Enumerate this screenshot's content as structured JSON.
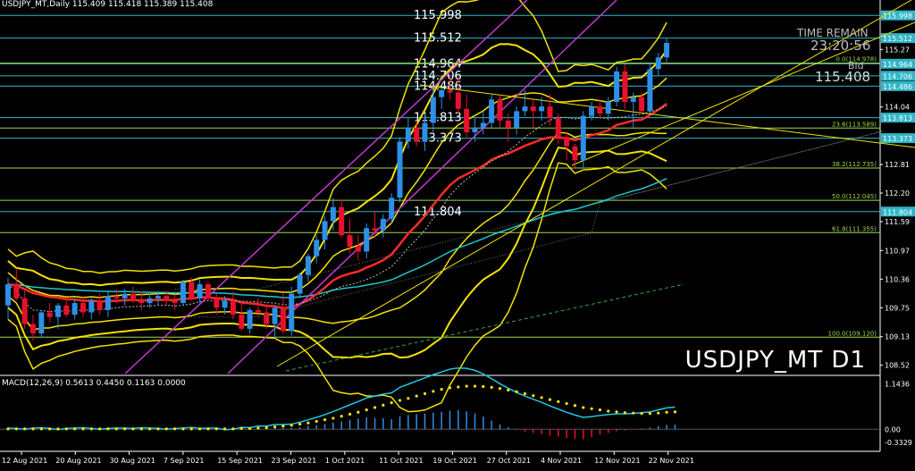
{
  "header": {
    "title": "USDJPY_MT,Daily  115.409 115.418 115.389 115.408",
    "macd_label": "MACD(12,26,9) 0.5613 0.4450 0.1163 0.0000",
    "watermark": "USDJPY_MT D1",
    "timer_label": "TIME REMAIN",
    "timer_value": "23:20:56",
    "bid_label": "Bid",
    "bid_value": "115.408"
  },
  "colors": {
    "background": "#000000",
    "bull": "#2e8fe6",
    "bear": "#e8112d",
    "bollinger": "#f3e300",
    "channel": "#c13ad1",
    "fib": "#9fd64f",
    "level": "#2fb6c7",
    "ema_fast": "#ff2b2b",
    "ema_slow": "#1ec8c8",
    "macd_line": "#1ec8e0",
    "macd_signal": "#ffe600",
    "axis_text": "#ffffff"
  },
  "chart_data": [
    {
      "type": "candlestick",
      "title": "USDJPY_MT,Daily",
      "x_ticks": [
        "12 Aug 2021",
        "20 Aug 2021",
        "30 Aug 2021",
        "7 Sep 2021",
        "15 Sep 2021",
        "23 Sep 2021",
        "1 Oct 2021",
        "11 Oct 2021",
        "19 Oct 2021",
        "27 Oct 2021",
        "4 Nov 2021",
        "12 Nov 2021",
        "22 Nov 2021"
      ],
      "y_ticks": [
        115.998,
        115.512,
        115.27,
        114.964,
        114.706,
        114.486,
        114.04,
        113.813,
        113.373,
        112.81,
        112.2,
        111.804,
        111.59,
        110.97,
        110.36,
        109.75,
        109.13,
        108.52
      ],
      "ylim": [
        108.38,
        116.25
      ],
      "grid": false,
      "candles": [
        {
          "date": "2021-08-05",
          "o": 109.8,
          "h": 110.38,
          "l": 109.5,
          "c": 110.25
        },
        {
          "date": "2021-08-06",
          "o": 110.25,
          "h": 110.6,
          "l": 109.9,
          "c": 109.95
        },
        {
          "date": "2021-08-09",
          "o": 109.95,
          "h": 110.15,
          "l": 109.3,
          "c": 109.4
        },
        {
          "date": "2021-08-10",
          "o": 109.4,
          "h": 109.6,
          "l": 109.05,
          "c": 109.2
        },
        {
          "date": "2021-08-11",
          "o": 109.2,
          "h": 109.7,
          "l": 109.1,
          "c": 109.65
        },
        {
          "date": "2021-08-12",
          "o": 109.65,
          "h": 109.85,
          "l": 109.45,
          "c": 109.55
        },
        {
          "date": "2021-08-13",
          "o": 109.55,
          "h": 109.85,
          "l": 109.3,
          "c": 109.8
        },
        {
          "date": "2021-08-16",
          "o": 109.8,
          "h": 109.95,
          "l": 109.55,
          "c": 109.6
        },
        {
          "date": "2021-08-17",
          "o": 109.6,
          "h": 109.95,
          "l": 109.5,
          "c": 109.85
        },
        {
          "date": "2021-08-18",
          "o": 109.85,
          "h": 110.0,
          "l": 109.55,
          "c": 109.65
        },
        {
          "date": "2021-08-19",
          "o": 109.65,
          "h": 109.95,
          "l": 109.5,
          "c": 109.9
        },
        {
          "date": "2021-08-20",
          "o": 109.9,
          "h": 110.05,
          "l": 109.6,
          "c": 109.7
        },
        {
          "date": "2021-08-23",
          "o": 109.7,
          "h": 110.1,
          "l": 109.55,
          "c": 110.0
        },
        {
          "date": "2021-08-24",
          "o": 110.0,
          "h": 110.15,
          "l": 109.85,
          "c": 109.95
        },
        {
          "date": "2021-08-25",
          "o": 109.95,
          "h": 110.15,
          "l": 109.8,
          "c": 110.05
        },
        {
          "date": "2021-08-26",
          "o": 110.05,
          "h": 110.2,
          "l": 109.85,
          "c": 109.9
        },
        {
          "date": "2021-08-27",
          "o": 109.9,
          "h": 110.1,
          "l": 109.7,
          "c": 109.85
        },
        {
          "date": "2021-08-30",
          "o": 109.85,
          "h": 110.05,
          "l": 109.75,
          "c": 109.95
        },
        {
          "date": "2021-08-31",
          "o": 109.95,
          "h": 110.1,
          "l": 109.8,
          "c": 110.0
        },
        {
          "date": "2021-09-01",
          "o": 110.0,
          "h": 110.1,
          "l": 109.8,
          "c": 109.9
        },
        {
          "date": "2021-09-02",
          "o": 109.9,
          "h": 110.05,
          "l": 109.7,
          "c": 109.85
        },
        {
          "date": "2021-09-03",
          "o": 109.85,
          "h": 110.35,
          "l": 109.8,
          "c": 110.3
        },
        {
          "date": "2021-09-06",
          "o": 110.3,
          "h": 110.4,
          "l": 109.9,
          "c": 109.95
        },
        {
          "date": "2021-09-07",
          "o": 109.95,
          "h": 110.35,
          "l": 109.85,
          "c": 110.25
        },
        {
          "date": "2021-09-08",
          "o": 110.25,
          "h": 110.3,
          "l": 109.9,
          "c": 109.95
        },
        {
          "date": "2021-09-09",
          "o": 109.95,
          "h": 110.05,
          "l": 109.6,
          "c": 109.75
        },
        {
          "date": "2021-09-10",
          "o": 109.75,
          "h": 110.0,
          "l": 109.6,
          "c": 109.9
        },
        {
          "date": "2021-09-13",
          "o": 109.9,
          "h": 110.1,
          "l": 109.5,
          "c": 109.6
        },
        {
          "date": "2021-09-14",
          "o": 109.6,
          "h": 109.9,
          "l": 109.25,
          "c": 109.3
        },
        {
          "date": "2021-09-15",
          "o": 109.3,
          "h": 109.75,
          "l": 109.2,
          "c": 109.7
        },
        {
          "date": "2021-09-16",
          "o": 109.7,
          "h": 109.95,
          "l": 109.55,
          "c": 109.65
        },
        {
          "date": "2021-09-17",
          "o": 109.65,
          "h": 109.85,
          "l": 109.3,
          "c": 109.4
        },
        {
          "date": "2021-09-20",
          "o": 109.4,
          "h": 109.8,
          "l": 109.1,
          "c": 109.75
        },
        {
          "date": "2021-09-21",
          "o": 109.75,
          "h": 110.05,
          "l": 109.2,
          "c": 109.25
        },
        {
          "date": "2021-09-22",
          "o": 109.25,
          "h": 110.2,
          "l": 109.15,
          "c": 110.05
        },
        {
          "date": "2021-09-23",
          "o": 110.05,
          "h": 110.5,
          "l": 109.95,
          "c": 110.45
        },
        {
          "date": "2021-09-24",
          "o": 110.45,
          "h": 110.9,
          "l": 110.3,
          "c": 110.85
        },
        {
          "date": "2021-09-27",
          "o": 110.85,
          "h": 111.3,
          "l": 110.7,
          "c": 111.2
        },
        {
          "date": "2021-09-28",
          "o": 111.2,
          "h": 111.7,
          "l": 111.0,
          "c": 111.6
        },
        {
          "date": "2021-09-29",
          "o": 111.6,
          "h": 112.1,
          "l": 111.4,
          "c": 111.9
        },
        {
          "date": "2021-09-30",
          "o": 111.9,
          "h": 112.05,
          "l": 111.25,
          "c": 111.3
        },
        {
          "date": "2021-10-01",
          "o": 111.3,
          "h": 111.65,
          "l": 110.9,
          "c": 111.05
        },
        {
          "date": "2021-10-04",
          "o": 111.05,
          "h": 111.3,
          "l": 110.75,
          "c": 110.95
        },
        {
          "date": "2021-10-05",
          "o": 110.95,
          "h": 111.55,
          "l": 110.8,
          "c": 111.45
        },
        {
          "date": "2021-10-06",
          "o": 111.45,
          "h": 111.8,
          "l": 111.25,
          "c": 111.4
        },
        {
          "date": "2021-10-07",
          "o": 111.4,
          "h": 111.75,
          "l": 111.25,
          "c": 111.65
        },
        {
          "date": "2021-10-08",
          "o": 111.65,
          "h": 112.2,
          "l": 111.55,
          "c": 112.1
        },
        {
          "date": "2021-10-11",
          "o": 112.1,
          "h": 113.4,
          "l": 112.0,
          "c": 113.3
        },
        {
          "date": "2021-10-12",
          "o": 113.3,
          "h": 113.8,
          "l": 113.15,
          "c": 113.6
        },
        {
          "date": "2021-10-13",
          "o": 113.6,
          "h": 113.75,
          "l": 113.2,
          "c": 113.3
        },
        {
          "date": "2021-10-14",
          "o": 113.3,
          "h": 113.9,
          "l": 113.1,
          "c": 113.7
        },
        {
          "date": "2021-10-15",
          "o": 113.7,
          "h": 114.4,
          "l": 113.5,
          "c": 114.25
        },
        {
          "date": "2021-10-18",
          "o": 114.25,
          "h": 114.45,
          "l": 114.0,
          "c": 114.4
        },
        {
          "date": "2021-10-19",
          "o": 114.4,
          "h": 114.7,
          "l": 114.2,
          "c": 114.35
        },
        {
          "date": "2021-10-20",
          "o": 114.35,
          "h": 114.69,
          "l": 113.9,
          "c": 114.0
        },
        {
          "date": "2021-10-21",
          "o": 114.0,
          "h": 114.3,
          "l": 113.4,
          "c": 113.5
        },
        {
          "date": "2021-10-22",
          "o": 113.5,
          "h": 113.8,
          "l": 113.3,
          "c": 113.6
        },
        {
          "date": "2021-10-25",
          "o": 113.6,
          "h": 113.95,
          "l": 113.45,
          "c": 113.7
        },
        {
          "date": "2021-10-26",
          "o": 113.7,
          "h": 114.3,
          "l": 113.6,
          "c": 114.2
        },
        {
          "date": "2021-10-27",
          "o": 114.2,
          "h": 114.3,
          "l": 113.6,
          "c": 113.75
        },
        {
          "date": "2021-10-28",
          "o": 113.75,
          "h": 113.9,
          "l": 113.3,
          "c": 113.6
        },
        {
          "date": "2021-10-29",
          "o": 113.6,
          "h": 114.05,
          "l": 113.45,
          "c": 113.95
        },
        {
          "date": "2021-11-01",
          "o": 113.95,
          "h": 114.4,
          "l": 113.85,
          "c": 114.05
        },
        {
          "date": "2021-11-02",
          "o": 114.05,
          "h": 114.2,
          "l": 113.6,
          "c": 113.95
        },
        {
          "date": "2021-11-03",
          "o": 113.95,
          "h": 114.25,
          "l": 113.75,
          "c": 114.05
        },
        {
          "date": "2021-11-04",
          "o": 114.05,
          "h": 114.3,
          "l": 113.65,
          "c": 113.8
        },
        {
          "date": "2021-11-05",
          "o": 113.8,
          "h": 113.9,
          "l": 113.25,
          "c": 113.4
        },
        {
          "date": "2021-11-08",
          "o": 113.4,
          "h": 113.5,
          "l": 112.9,
          "c": 113.2
        },
        {
          "date": "2021-11-09",
          "o": 113.2,
          "h": 113.25,
          "l": 112.75,
          "c": 112.9
        },
        {
          "date": "2021-11-10",
          "o": 112.9,
          "h": 113.95,
          "l": 112.75,
          "c": 113.85
        },
        {
          "date": "2021-11-11",
          "o": 113.85,
          "h": 114.15,
          "l": 113.75,
          "c": 114.05
        },
        {
          "date": "2021-11-12",
          "o": 114.05,
          "h": 114.2,
          "l": 113.8,
          "c": 113.9
        },
        {
          "date": "2021-11-15",
          "o": 113.9,
          "h": 114.25,
          "l": 113.75,
          "c": 114.15
        },
        {
          "date": "2021-11-16",
          "o": 114.15,
          "h": 114.9,
          "l": 114.05,
          "c": 114.8
        },
        {
          "date": "2021-11-17",
          "o": 114.8,
          "h": 114.95,
          "l": 114.0,
          "c": 114.15
        },
        {
          "date": "2021-11-18",
          "o": 114.15,
          "h": 114.35,
          "l": 113.6,
          "c": 114.25
        },
        {
          "date": "2021-11-19",
          "o": 114.25,
          "h": 114.35,
          "l": 113.9,
          "c": 113.95
        },
        {
          "date": "2021-11-22",
          "o": 113.95,
          "h": 114.95,
          "l": 113.9,
          "c": 114.85
        },
        {
          "date": "2021-11-23",
          "o": 114.85,
          "h": 115.2,
          "l": 114.7,
          "c": 115.1
        },
        {
          "date": "2021-11-24",
          "o": 115.1,
          "h": 115.52,
          "l": 115.0,
          "c": 115.41
        }
      ],
      "horizontal_levels": [
        115.998,
        115.512,
        114.964,
        114.706,
        114.486,
        113.813,
        113.373,
        111.804
      ],
      "fibonacci": [
        {
          "label": "0.0(114.978)",
          "value": 114.978
        },
        {
          "label": "23.6(113.589)",
          "value": 113.589
        },
        {
          "label": "38.2(112.735)",
          "value": 112.735
        },
        {
          "label": "50.0(112.045)",
          "value": 112.045
        },
        {
          "label": "61.8(111.355)",
          "value": 111.355
        },
        {
          "label": "100.0(109.120)",
          "value": 109.12
        }
      ]
    },
    {
      "type": "bar",
      "title": "MACD(12,26,9)",
      "y_ticks": [
        1.1436,
        0,
        -0.3329
      ],
      "y_tick_labels": [
        "1.1436",
        "0.00",
        "-0.3329"
      ],
      "ylim": [
        -0.4,
        1.25
      ],
      "series": [
        {
          "name": "histogram",
          "values": [
            0.02,
            0.01,
            -0.01,
            0.02,
            0.03,
            0.01,
            -0.02,
            0.01,
            0.02,
            0.03,
            0.01,
            -0.01,
            0.01,
            0.02,
            0.02,
            0.01,
            0.03,
            0.02,
            0.01,
            -0.01,
            0.01,
            0.02,
            0.04,
            0.01,
            0.02,
            0.02,
            -0.02,
            -0.01,
            0.03,
            0.02,
            0.05,
            0.04,
            0.06,
            0.04,
            0.03,
            0.05,
            0.08,
            0.1,
            0.13,
            0.17,
            0.2,
            0.24,
            0.27,
            0.3,
            0.29,
            0.28,
            0.25,
            0.33,
            0.36,
            0.38,
            0.4,
            0.42,
            0.44,
            0.47,
            0.48,
            0.45,
            0.4,
            0.32,
            0.22,
            0.12,
            0.05,
            -0.02,
            -0.06,
            -0.09,
            -0.12,
            -0.16,
            -0.19,
            -0.22,
            -0.24,
            -0.25,
            -0.2,
            -0.14,
            -0.09,
            -0.05,
            -0.03,
            -0.01,
            0.02,
            0.04,
            0.08,
            0.11,
            0.12
          ]
        },
        {
          "name": "signal",
          "values": [
            0.01,
            0.01,
            0.01,
            0.01,
            0.01,
            0.01,
            0.01,
            0.01,
            0.01,
            0.01,
            0.01,
            0.01,
            0.01,
            0.01,
            0.01,
            0.01,
            0.01,
            0.01,
            0.01,
            0.01,
            0.01,
            0.01,
            0.01,
            0.01,
            0.01,
            0.01,
            0.01,
            0.01,
            0.02,
            0.02,
            0.03,
            0.04,
            0.06,
            0.08,
            0.1,
            0.13,
            0.16,
            0.2,
            0.24,
            0.28,
            0.33,
            0.38,
            0.43,
            0.49,
            0.55,
            0.61,
            0.67,
            0.73,
            0.78,
            0.84,
            0.9,
            0.96,
            1.01,
            1.05,
            1.07,
            1.09,
            1.09,
            1.08,
            1.06,
            1.03,
            0.99,
            0.95,
            0.9,
            0.85,
            0.8,
            0.75,
            0.7,
            0.65,
            0.6,
            0.55,
            0.52,
            0.49,
            0.46,
            0.44,
            0.42,
            0.41,
            0.4,
            0.4,
            0.41,
            0.43,
            0.44
          ]
        },
        {
          "name": "macd",
          "values": [
            0.03,
            0.02,
            0.0,
            0.03,
            0.04,
            0.02,
            -0.01,
            0.02,
            0.03,
            0.04,
            0.02,
            0.0,
            0.02,
            0.03,
            0.03,
            0.02,
            0.04,
            0.03,
            0.02,
            0.0,
            0.02,
            0.03,
            0.05,
            0.02,
            0.03,
            0.03,
            -0.01,
            0.0,
            0.05,
            0.04,
            0.08,
            0.08,
            0.12,
            0.12,
            0.13,
            0.18,
            0.24,
            0.3,
            0.37,
            0.45,
            0.53,
            0.62,
            0.7,
            0.79,
            0.84,
            0.89,
            0.92,
            1.06,
            1.14,
            1.22,
            1.3,
            1.38,
            1.45,
            1.52,
            1.55,
            1.54,
            1.49,
            1.4,
            1.28,
            1.15,
            1.04,
            0.93,
            0.84,
            0.76,
            0.68,
            0.59,
            0.51,
            0.43,
            0.36,
            0.3,
            0.32,
            0.35,
            0.37,
            0.39,
            0.39,
            0.4,
            0.42,
            0.44,
            0.49,
            0.54,
            0.56
          ]
        }
      ]
    }
  ]
}
